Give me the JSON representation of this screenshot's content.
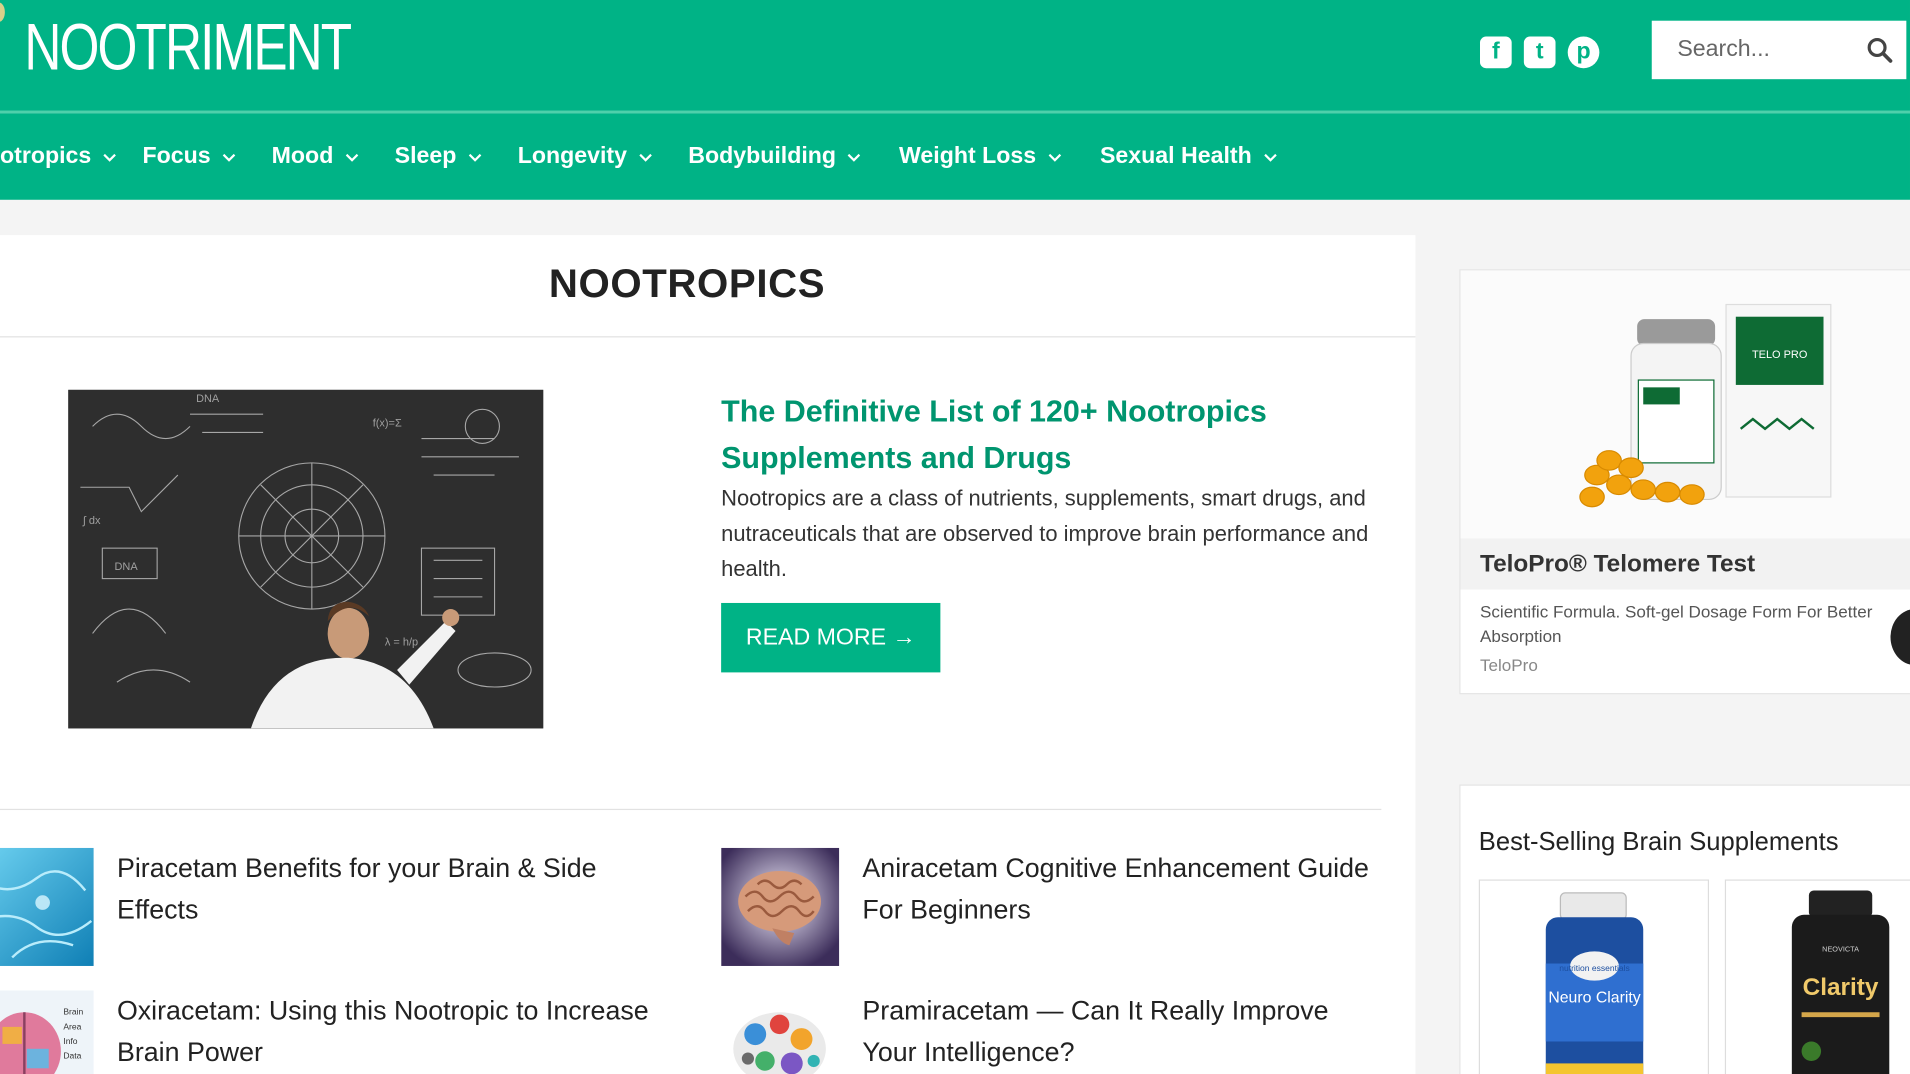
{
  "site": {
    "logo": "NOOTRIMENT"
  },
  "header": {
    "social": [
      {
        "name": "facebook",
        "glyph": "f"
      },
      {
        "name": "twitter",
        "glyph": "t"
      },
      {
        "name": "pinterest",
        "glyph": "p"
      }
    ],
    "search_placeholder": "Search..."
  },
  "nav": {
    "items": [
      {
        "label": "otropics"
      },
      {
        "label": "Focus"
      },
      {
        "label": "Mood"
      },
      {
        "label": "Sleep"
      },
      {
        "label": "Longevity"
      },
      {
        "label": "Bodybuilding"
      },
      {
        "label": "Weight Loss"
      },
      {
        "label": "Sexual Health"
      }
    ]
  },
  "main": {
    "page_title": "NOOTROPICS",
    "featured": {
      "title": "The Definitive List of 120+ Nootropics Supplements and Drugs",
      "excerpt": "Nootropics are a class of nutrients, supplements, smart drugs, and nutraceuticals that are observed to improve brain performance and health.",
      "read_more": "READ MORE →"
    },
    "posts": [
      {
        "title": "Piracetam Benefits for your Brain & Side Effects"
      },
      {
        "title": "Aniracetam Cognitive Enhancement Guide For Beginners"
      },
      {
        "title": "Oxiracetam: Using this Nootropic to Increase Brain Power"
      },
      {
        "title": "Pramiracetam — Can It Really Improve Your Intelligence?"
      }
    ]
  },
  "sidebar": {
    "ad": {
      "title": "TeloPro® Telomere Test",
      "description": "Scientific Formula. Soft-gel Dosage Form For Better Absorption",
      "brand": "TeloPro",
      "box_label": "TELO PRO"
    },
    "best_selling": {
      "title": "Best-Selling Brain Supplements",
      "products": [
        {
          "brand": "nutrition essentials",
          "name": "Neuro Clarity"
        },
        {
          "brand": "NEOVICTA",
          "name": "Clarity"
        }
      ]
    }
  },
  "colors": {
    "brand": "#00b386",
    "accent_text": "#00956f"
  }
}
